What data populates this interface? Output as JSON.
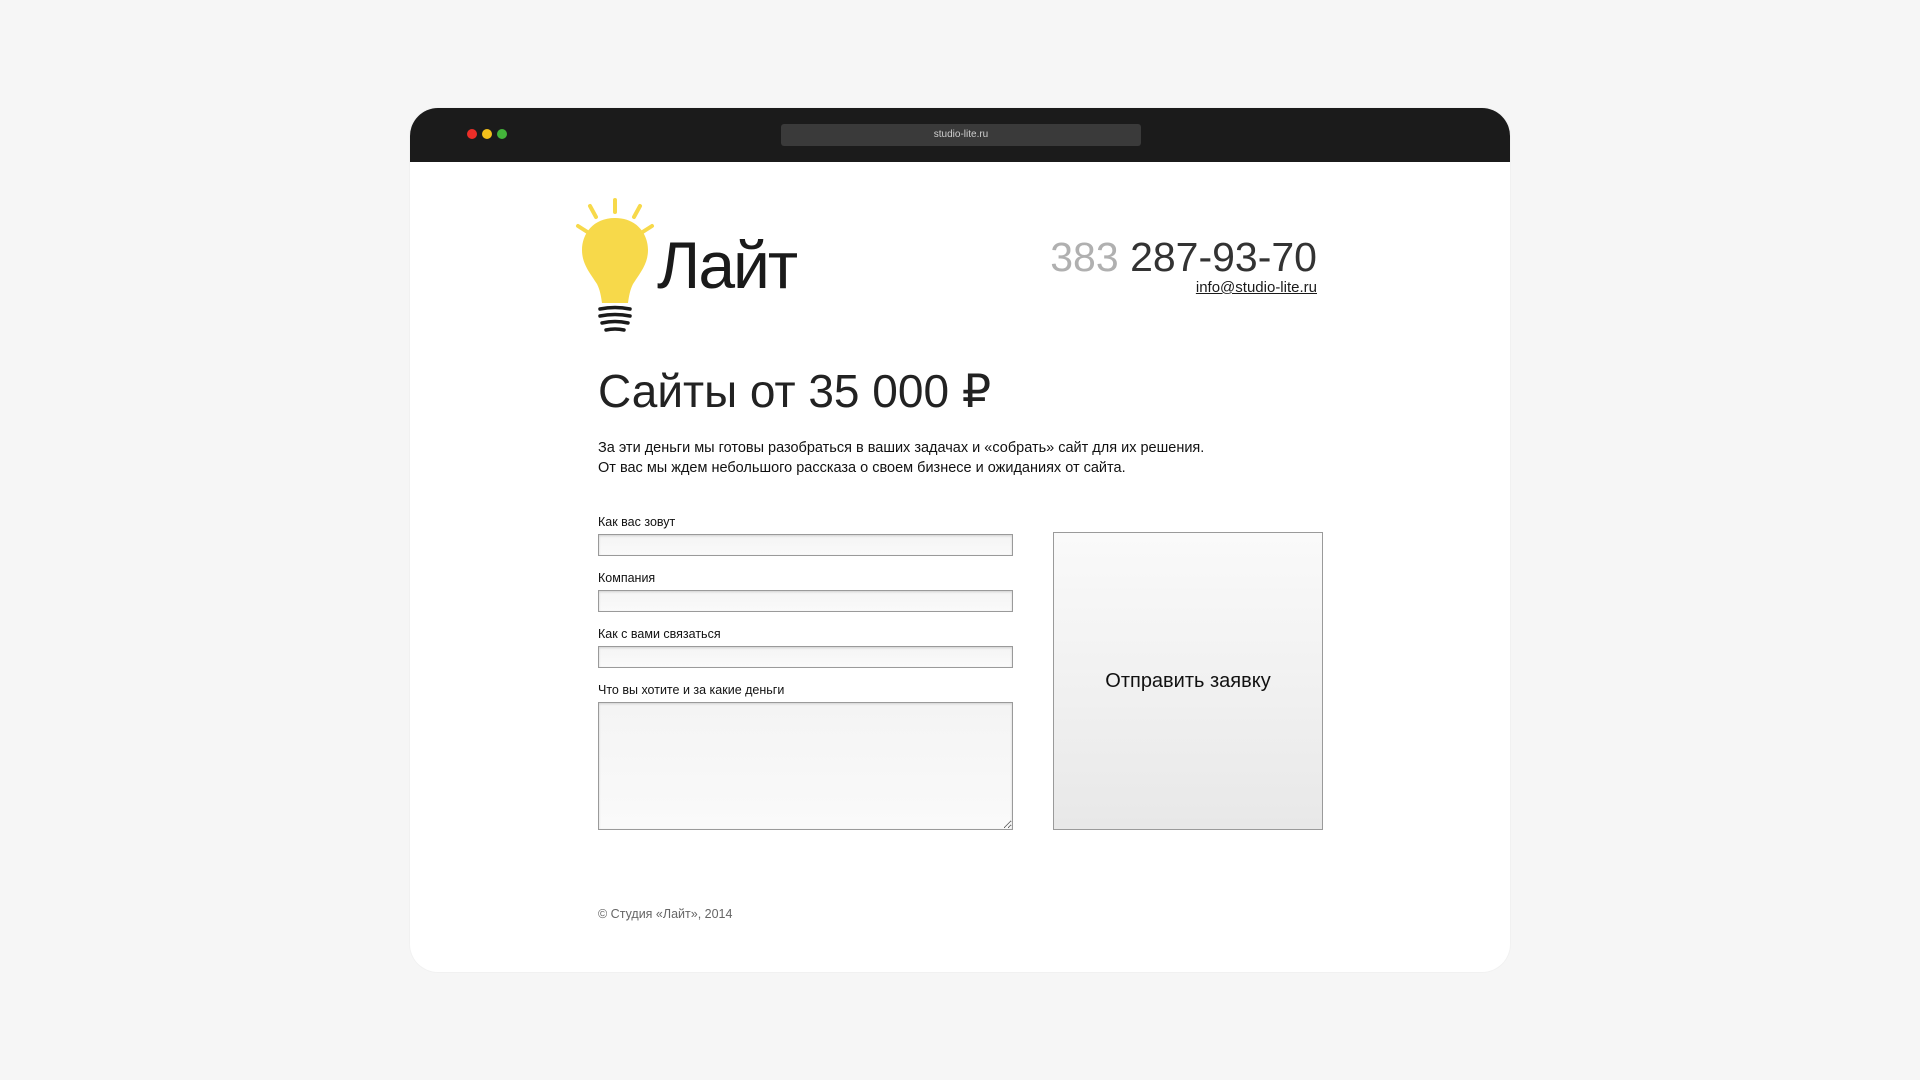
{
  "window": {
    "url": "studio-lite.ru"
  },
  "header": {
    "logo_text": "Лайт",
    "phone_code": "383",
    "phone_number": "287-93-70",
    "email": "info@studio-lite.ru"
  },
  "main": {
    "headline": "Сайты от 35 000 ₽",
    "description_line1": "За эти деньги мы готовы разобраться в ваших задачах и «собрать» сайт для их решения.",
    "description_line2": "От вас мы ждем небольшого рассказа о своем бизнесе и ожиданиях от сайта."
  },
  "form": {
    "name_label": "Как вас зовут",
    "name_value": "",
    "company_label": "Компания",
    "company_value": "",
    "contact_label": "Как с вами связаться",
    "contact_value": "",
    "request_label": "Что вы хотите и за какие деньги",
    "request_value": "",
    "submit_label": "Отправить заявку"
  },
  "footer": {
    "copyright": "© Студия «Лайт», 2014"
  },
  "colors": {
    "bulb": "#f7d94a",
    "window_chrome": "#1b1b1b",
    "page_bg": "#f6f6f6"
  },
  "icons": {
    "logo": "lightbulb-icon"
  }
}
